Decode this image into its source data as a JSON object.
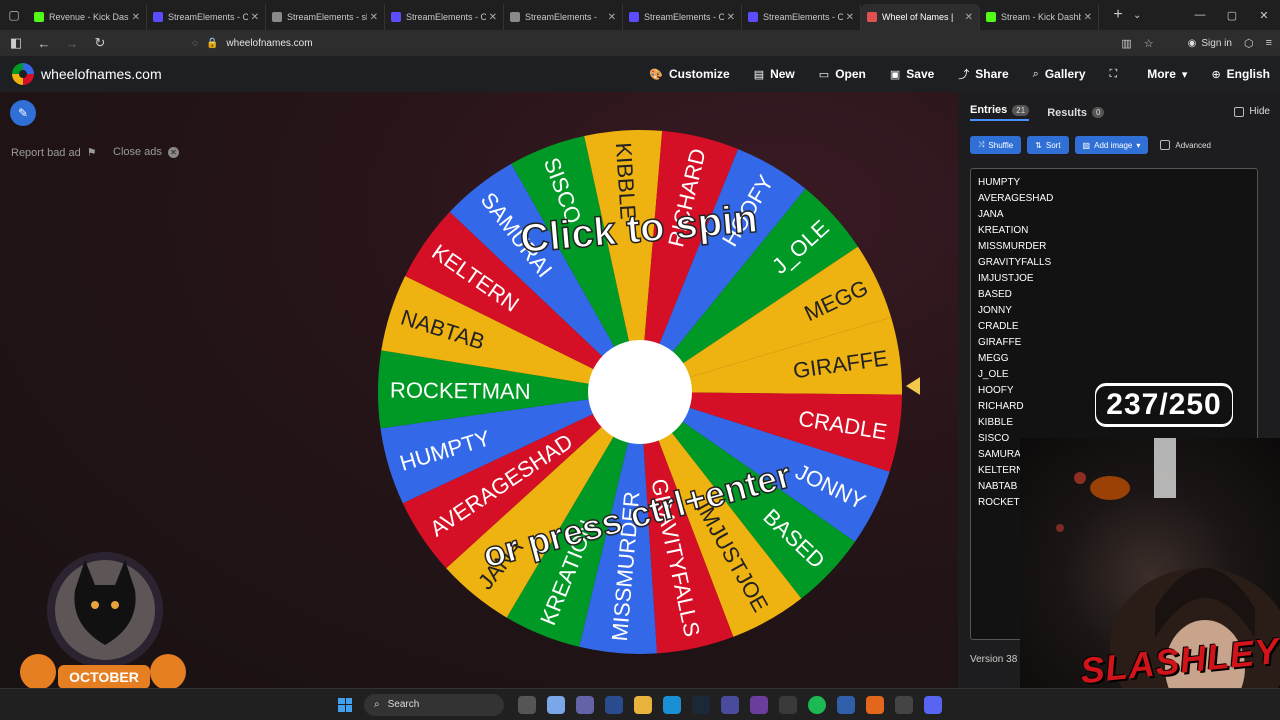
{
  "browser": {
    "tabs": [
      {
        "title": "Revenue - Kick Dashbo",
        "favicon_color": "#53fc18"
      },
      {
        "title": "StreamElements - Over",
        "favicon_color": "#5b4cff"
      },
      {
        "title": "StreamElements - slash",
        "favicon_color": "#8a8a8a"
      },
      {
        "title": "StreamElements - Over",
        "favicon_color": "#5b4cff"
      },
      {
        "title": "StreamElements - ",
        "favicon_color": "#8a8a8a"
      },
      {
        "title": "StreamElements - Over",
        "favicon_color": "#5b4cff"
      },
      {
        "title": "StreamElements - Over",
        "favicon_color": "#5b4cff"
      },
      {
        "title": "Wheel of Names |",
        "favicon_color": "#e24f4f",
        "active": true
      },
      {
        "title": "Stream - Kick Dashboa",
        "favicon_color": "#53fc18"
      }
    ],
    "url": "wheelofnames.com",
    "signin_label": "Sign in"
  },
  "site": {
    "title": "wheelofnames.com",
    "menu": [
      {
        "label": "Customize",
        "icon": "palette-icon",
        "glyph": "🎨"
      },
      {
        "label": "New",
        "icon": "file-icon",
        "glyph": "▤"
      },
      {
        "label": "Open",
        "icon": "folder-icon",
        "glyph": "▭"
      },
      {
        "label": "Save",
        "icon": "save-icon",
        "glyph": "▣"
      },
      {
        "label": "Share",
        "icon": "share-icon",
        "glyph": "⤴"
      },
      {
        "label": "Gallery",
        "icon": "search-icon",
        "glyph": "⌕"
      },
      {
        "label": "",
        "icon": "fullscreen-icon",
        "glyph": "⛶"
      },
      {
        "label": "More",
        "icon": "chevron-down-icon",
        "glyph": "▾"
      },
      {
        "label": "English",
        "icon": "globe-icon",
        "glyph": "⊕"
      }
    ]
  },
  "ads": {
    "report_label": "Report bad ad",
    "close_label": "Close ads"
  },
  "wheel": {
    "center_text_top": "Click to spin",
    "center_text_bottom": "or press ctrl+enter",
    "colors": [
      "#eeb211",
      "#d50f25",
      "#3369e8",
      "#009925"
    ],
    "start_name": "GIRAFFE"
  },
  "panel": {
    "entries_tab": "Entries",
    "entries_count": "21",
    "results_tab": "Results",
    "results_count": "0",
    "hide_label": "Hide",
    "shuffle_label": "Shuffle",
    "sort_label": "Sort",
    "add_image_label": "Add image",
    "advanced_label": "Advanced",
    "entries": [
      "HUMPTY",
      "AVERAGESHAD",
      "JANA",
      "KREATION",
      "MISSMURDER",
      "GRAVITYFALLS",
      "IMJUSTJOE",
      "BASED",
      "JONNY",
      "CRADLE",
      "GIRAFFE",
      "MEGG",
      "J_OLE",
      "HOOFY",
      "RICHARD",
      "KIBBLE",
      "SISCO",
      "SAMURAI",
      "KELTERN",
      "NABTAB",
      "ROCKETMAN"
    ],
    "version_label": "Version 38"
  },
  "overlay": {
    "counter": "237/250",
    "streamer_name": "SLASHLEY",
    "banner_label": "OCTOBER"
  },
  "taskbar": {
    "search_label": "Search"
  }
}
